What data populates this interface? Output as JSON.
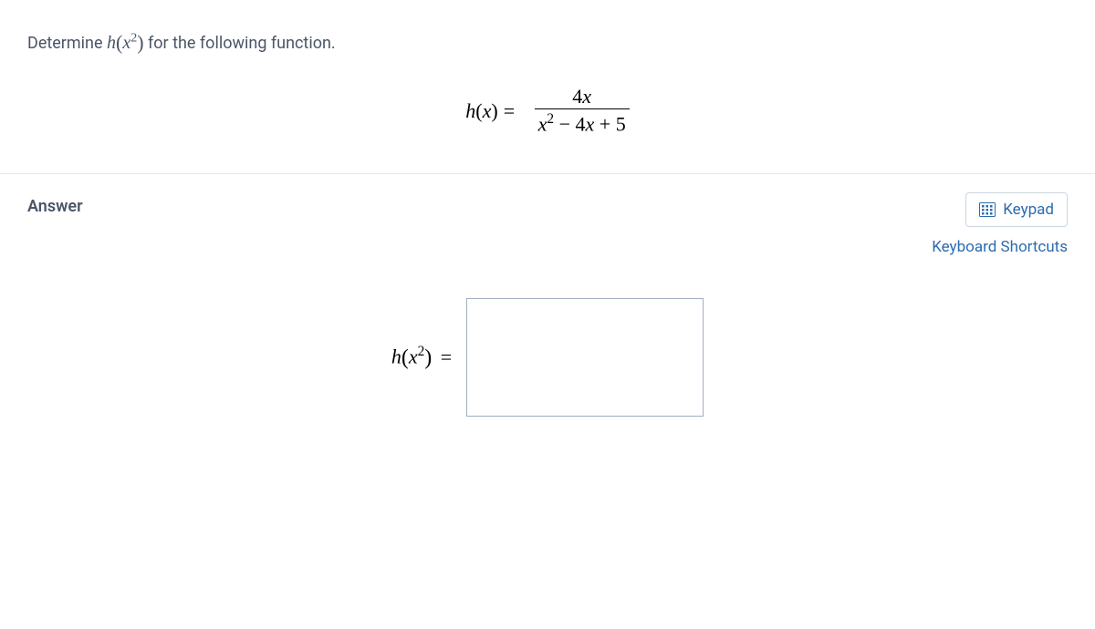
{
  "question": {
    "prefix": "Determine ",
    "target_expr": "h(x²)",
    "suffix": " for the following function."
  },
  "function_def": {
    "lhs": "h(x)",
    "numerator": "4x",
    "denominator": "x² − 4x + 5"
  },
  "answer_section": {
    "label": "Answer",
    "keypad_label": "Keypad",
    "shortcuts_label": "Keyboard Shortcuts",
    "input_lhs": "h(x²)",
    "input_value": ""
  }
}
